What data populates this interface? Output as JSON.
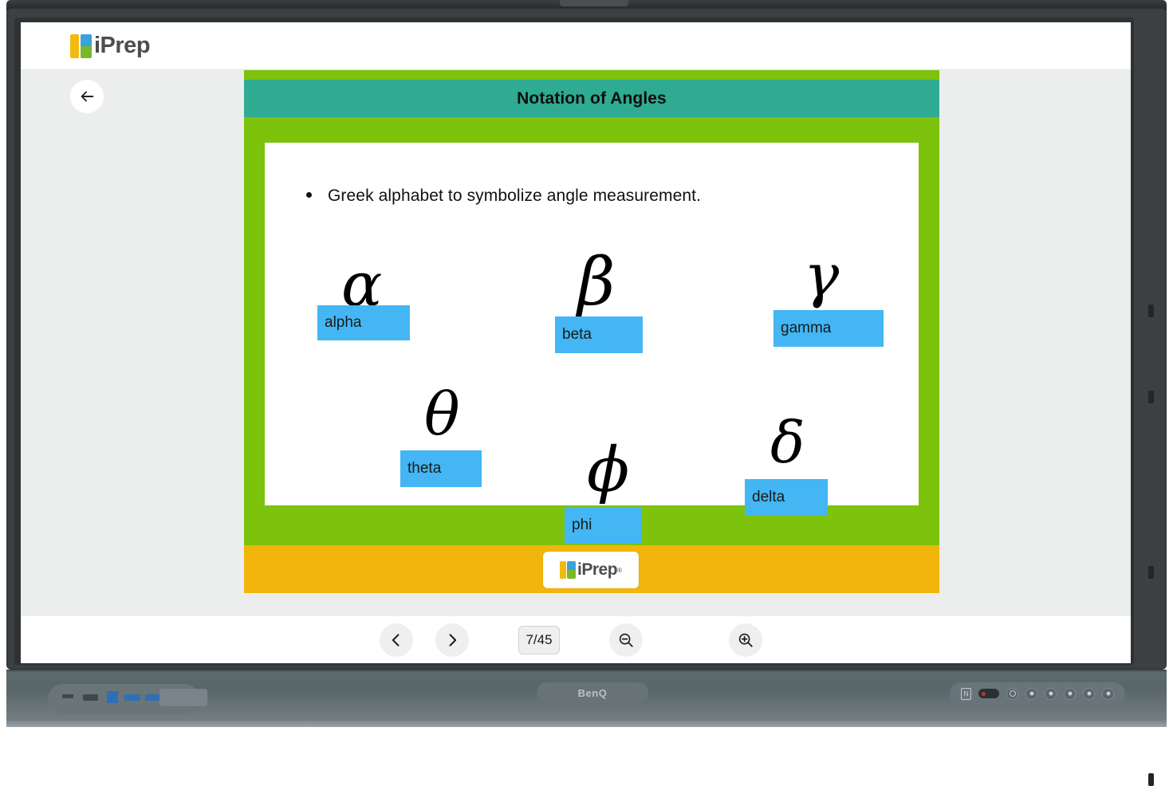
{
  "app": {
    "brand": "iPrep",
    "brand_registered": "®",
    "brand_colors": {
      "yellow": "#f2b90e",
      "blue": "#3aa3dc",
      "green": "#7ab829",
      "text": "#4d4d4d"
    },
    "back_button_icon": "arrow-left-icon"
  },
  "slide": {
    "title": "Notation of Angles",
    "bullet": "Greek alphabet to symbolize angle measurement.",
    "colors": {
      "header_band": "#2fab92",
      "frame_green": "#7dc20d",
      "footer_orange": "#f2b50c",
      "tag_blue": "#43b6f3"
    },
    "symbols": [
      {
        "glyph": "α",
        "label": "alpha"
      },
      {
        "glyph": "β",
        "label": "beta"
      },
      {
        "glyph": "γ",
        "label": "gamma"
      },
      {
        "glyph": "θ",
        "label": "theta"
      },
      {
        "glyph": "ϕ",
        "label": "phi"
      },
      {
        "glyph": "δ",
        "label": "delta"
      }
    ]
  },
  "toolbar": {
    "prev_icon": "chevron-left-icon",
    "next_icon": "chevron-right-icon",
    "page_indicator": "7/45",
    "current_page": 7,
    "total_pages": 45,
    "zoom_out_icon": "magnifier-minus-icon",
    "zoom_in_icon": "magnifier-plus-icon"
  },
  "device": {
    "brand": "BenQ",
    "nfc_label": "N"
  }
}
